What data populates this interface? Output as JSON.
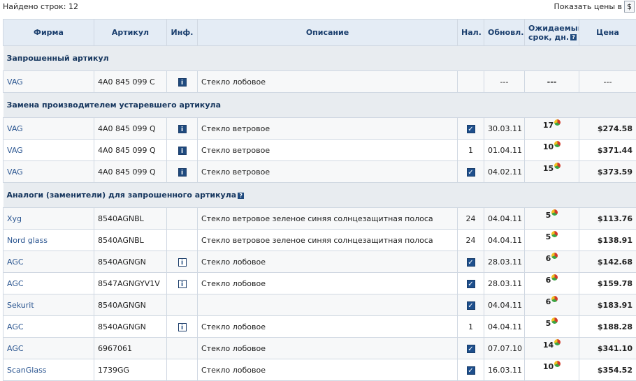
{
  "found_label": "Найдено строк: 12",
  "currency_label": "Показать цены в",
  "currency_value": "$",
  "headers": {
    "brand": "Фирма",
    "article": "Артикул",
    "info": "Инф.",
    "description": "Описание",
    "stock": "Нал.",
    "updated": "Обновл.",
    "expected_line1": "Ожидаемый",
    "expected_line2": "срок, дн.",
    "price": "Цена"
  },
  "sections": [
    {
      "title": "Запрошенный артикул",
      "help": false,
      "rows": [
        {
          "brand": "VAG",
          "article": "4A0 845 099 C",
          "info": "filled",
          "description": "Стекло лобовое",
          "stock": "",
          "stock_check": false,
          "updated": "---",
          "days": "---",
          "days_pie": false,
          "price": "---"
        }
      ]
    },
    {
      "title": "Замена производителем устаревшего артикула",
      "help": false,
      "rows": [
        {
          "brand": "VAG",
          "article": "4A0 845 099 Q",
          "info": "filled",
          "description": "Стекло ветровое",
          "stock": "",
          "stock_check": true,
          "updated": "30.03.11",
          "days": "17",
          "days_pie": true,
          "price": "$274.58"
        },
        {
          "brand": "VAG",
          "article": "4A0 845 099 Q",
          "info": "filled",
          "description": "Стекло ветровое",
          "stock": "1",
          "stock_check": false,
          "updated": "01.04.11",
          "days": "10",
          "days_pie": true,
          "price": "$371.44"
        },
        {
          "brand": "VAG",
          "article": "4A0 845 099 Q",
          "info": "filled",
          "description": "Стекло ветровое",
          "stock": "",
          "stock_check": true,
          "updated": "04.02.11",
          "days": "15",
          "days_pie": true,
          "price": "$373.59"
        }
      ]
    },
    {
      "title": "Аналоги (заменители) для запрошенного артикула",
      "help": true,
      "rows": [
        {
          "brand": "Xyg",
          "article": "8540AGNBL",
          "info": "",
          "description": "Стекло ветровое зеленое синяя солнцезащитная полоса",
          "stock": "24",
          "stock_check": false,
          "updated": "04.04.11",
          "days": "5",
          "days_pie": true,
          "price": "$113.76"
        },
        {
          "brand": "Nord glass",
          "article": "8540AGNBL",
          "info": "",
          "description": "Стекло ветровое зеленое синяя солнцезащитная полоса",
          "stock": "24",
          "stock_check": false,
          "updated": "04.04.11",
          "days": "5",
          "days_pie": true,
          "price": "$138.91"
        },
        {
          "brand": "AGC",
          "article": "8540AGNGN",
          "info": "outline",
          "description": "Стекло лобовое",
          "stock": "",
          "stock_check": true,
          "updated": "28.03.11",
          "days": "6",
          "days_pie": true,
          "price": "$142.68"
        },
        {
          "brand": "AGC",
          "article": "8547AGNGYV1V",
          "info": "outline",
          "description": "Стекло лобовое",
          "stock": "",
          "stock_check": true,
          "updated": "28.03.11",
          "days": "6",
          "days_pie": true,
          "price": "$159.78"
        },
        {
          "brand": "Sekurit",
          "article": "8540AGNGN",
          "info": "",
          "description": "",
          "stock": "",
          "stock_check": true,
          "updated": "04.04.11",
          "days": "6",
          "days_pie": true,
          "price": "$183.91"
        },
        {
          "brand": "AGC",
          "article": "8540AGNGN",
          "info": "outline",
          "description": "Стекло лобовое",
          "stock": "1",
          "stock_check": false,
          "updated": "04.04.11",
          "days": "5",
          "days_pie": true,
          "price": "$188.28"
        },
        {
          "brand": "AGC",
          "article": "6967061",
          "info": "",
          "description": "Стекло лобовое",
          "stock": "",
          "stock_check": true,
          "updated": "07.07.10",
          "days": "14",
          "days_pie": true,
          "price": "$341.10"
        },
        {
          "brand": "ScanGlass",
          "article": "1739GG",
          "info": "",
          "description": "Стекло лобовое",
          "stock": "",
          "stock_check": true,
          "updated": "16.03.11",
          "days": "10",
          "days_pie": true,
          "price": "$354.52"
        }
      ]
    }
  ]
}
